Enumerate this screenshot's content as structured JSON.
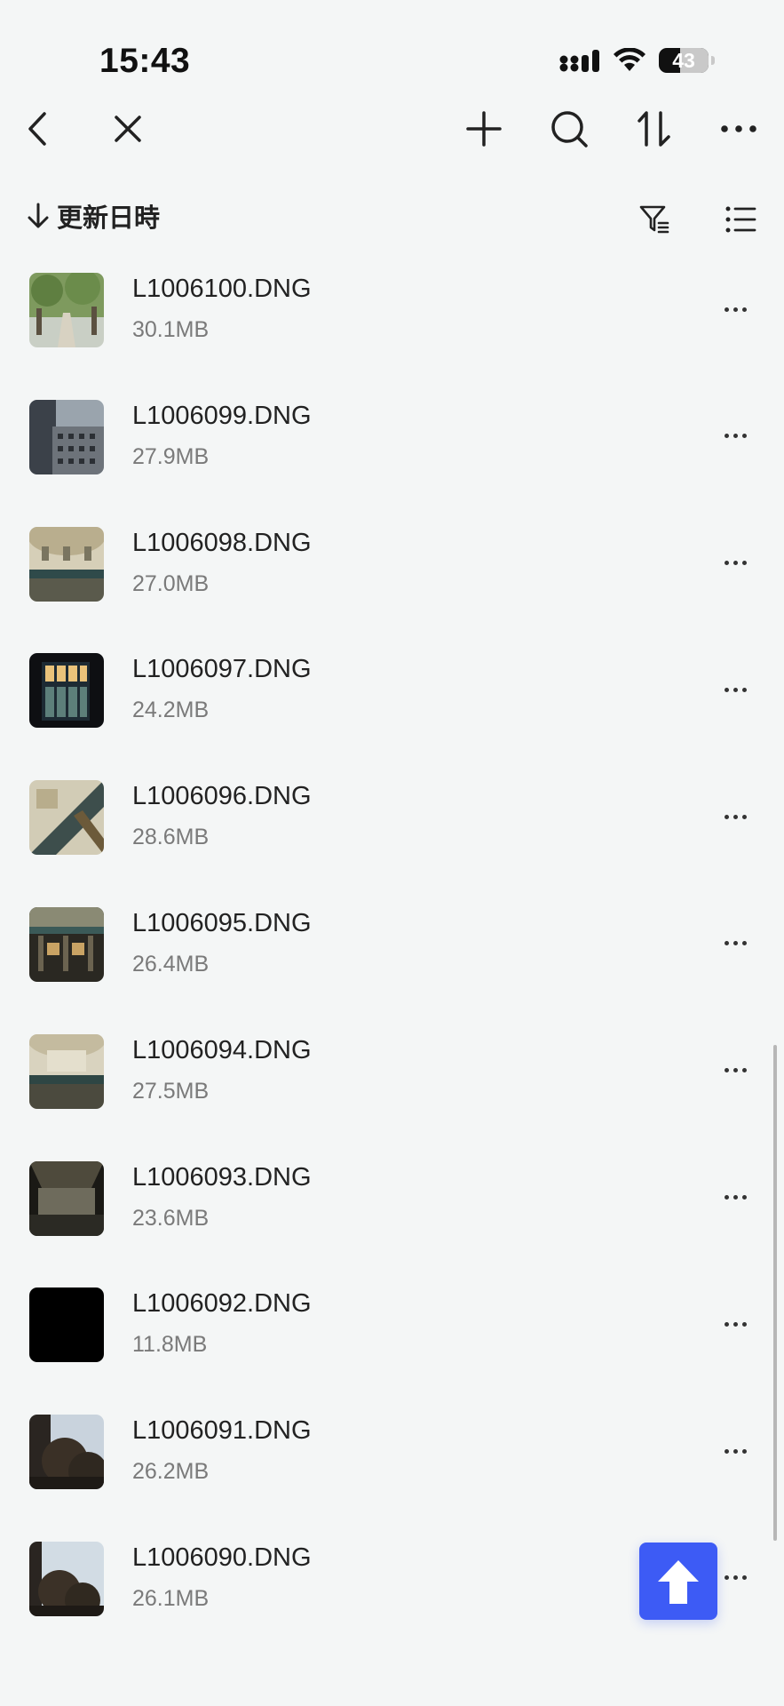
{
  "status_bar": {
    "time": "15:43",
    "battery": "43"
  },
  "nav": {
    "back_icon": "chevron-left-icon",
    "close_icon": "close-icon",
    "add_icon": "plus-icon",
    "search_icon": "search-icon",
    "sort_icon": "sort-arrows-icon",
    "more_icon": "more-horizontal-icon"
  },
  "sort_bar": {
    "label": "更新日時",
    "direction_icon": "arrow-down-icon",
    "filter_icon": "filter-icon",
    "view_icon": "list-view-icon"
  },
  "files": [
    {
      "name": "L1006100.DNG",
      "size": "30.1MB",
      "thumb": "garden-path"
    },
    {
      "name": "L1006099.DNG",
      "size": "27.9MB",
      "thumb": "office-building"
    },
    {
      "name": "L1006098.DNG",
      "size": "27.0MB",
      "thumb": "dome-interior"
    },
    {
      "name": "L1006097.DNG",
      "size": "24.2MB",
      "thumb": "lit-windows"
    },
    {
      "name": "L1006096.DNG",
      "size": "28.6MB",
      "thumb": "dome-interior"
    },
    {
      "name": "L1006095.DNG",
      "size": "26.4MB",
      "thumb": "station-hall"
    },
    {
      "name": "L1006094.DNG",
      "size": "27.5MB",
      "thumb": "dome-interior"
    },
    {
      "name": "L1006093.DNG",
      "size": "23.6MB",
      "thumb": "dome-dark"
    },
    {
      "name": "L1006092.DNG",
      "size": "11.8MB",
      "thumb": "black"
    },
    {
      "name": "L1006091.DNG",
      "size": "26.2MB",
      "thumb": "tree-sky"
    },
    {
      "name": "L1006090.DNG",
      "size": "26.1MB",
      "thumb": "tree-sky"
    }
  ],
  "fab": {
    "icon": "upload-arrow-icon",
    "color": "#3d5bf5"
  },
  "colors": {
    "background": "#f4f6f6",
    "text_primary": "#222222",
    "text_secondary": "#7a7a7a",
    "accent": "#3d5bf5"
  }
}
